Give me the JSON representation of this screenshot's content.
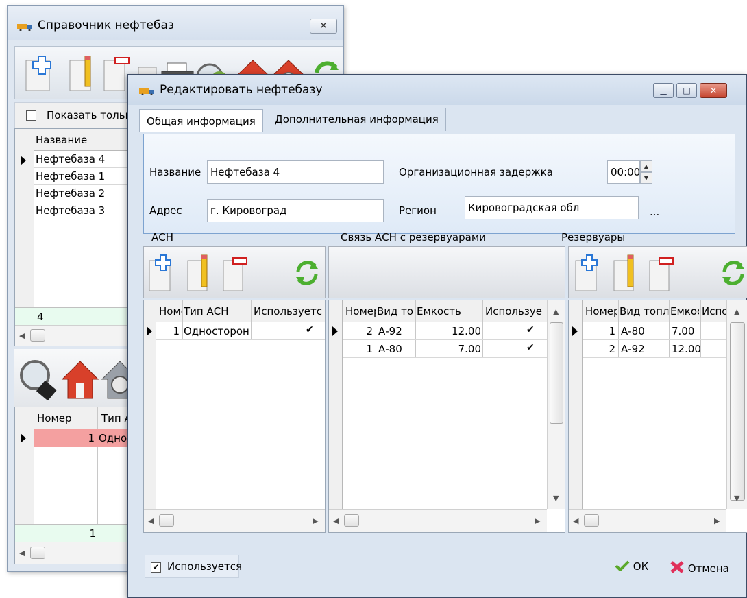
{
  "back_window": {
    "title": "Справочник нефтебаз",
    "close_label": "✕",
    "show_only_label": "Показать только",
    "grid": {
      "header": "Название",
      "rows": [
        "Нефтебаза 4",
        "Нефтебаза 1",
        "Нефтебаза 2",
        "Нефтебаза 3"
      ],
      "footer": "4"
    },
    "bottom_grid": {
      "col_number": "Номер",
      "col_type": "Тип АС",
      "row_number": "1",
      "row_type": "Однос",
      "footer": "1"
    }
  },
  "front_window": {
    "title": "Редактировать нефтебазу",
    "tabs": [
      "Общая информация",
      "Дополнительная информация"
    ],
    "fields": {
      "name_label": "Название",
      "name_value": "Нефтебаза 4",
      "address_label": "Адрес",
      "address_value": "г. Кировоград",
      "delay_label": "Организационная задержка",
      "delay_value": "00:00",
      "region_label": "Регион",
      "region_value": "Кировоградская обл",
      "region_button": "..."
    },
    "sections": {
      "ach": "АСН",
      "link": "Связь АСН с резервуарами",
      "tanks": "Резервуары"
    },
    "ach_grid": {
      "headers": [
        "Номе",
        "Тип АСН",
        "Используетс"
      ],
      "rows": [
        {
          "num": "1",
          "type": "Односторон",
          "used": "✔"
        }
      ]
    },
    "link_grid": {
      "headers": [
        "Номер",
        "Вид то",
        "Емкость",
        "Используе"
      ],
      "rows": [
        {
          "num": "2",
          "fuel": "А-92",
          "cap": "12.00",
          "used": "✔"
        },
        {
          "num": "1",
          "fuel": "А-80",
          "cap": "7.00",
          "used": "✔"
        }
      ]
    },
    "tank_grid": {
      "headers": [
        "Номер",
        "Вид топл",
        "Емкос",
        "Испо"
      ],
      "rows": [
        {
          "num": "1",
          "fuel": "А-80",
          "cap": "7.00"
        },
        {
          "num": "2",
          "fuel": "А-92",
          "cap": "12.00"
        }
      ]
    },
    "used_checkbox_label": "Используется",
    "ok_label": "ОК",
    "cancel_label": "Отмена"
  },
  "colors": {
    "selected_row": "#f4a0a0",
    "footer_green": "#e8fbef",
    "panel_border": "#7da3d0"
  }
}
